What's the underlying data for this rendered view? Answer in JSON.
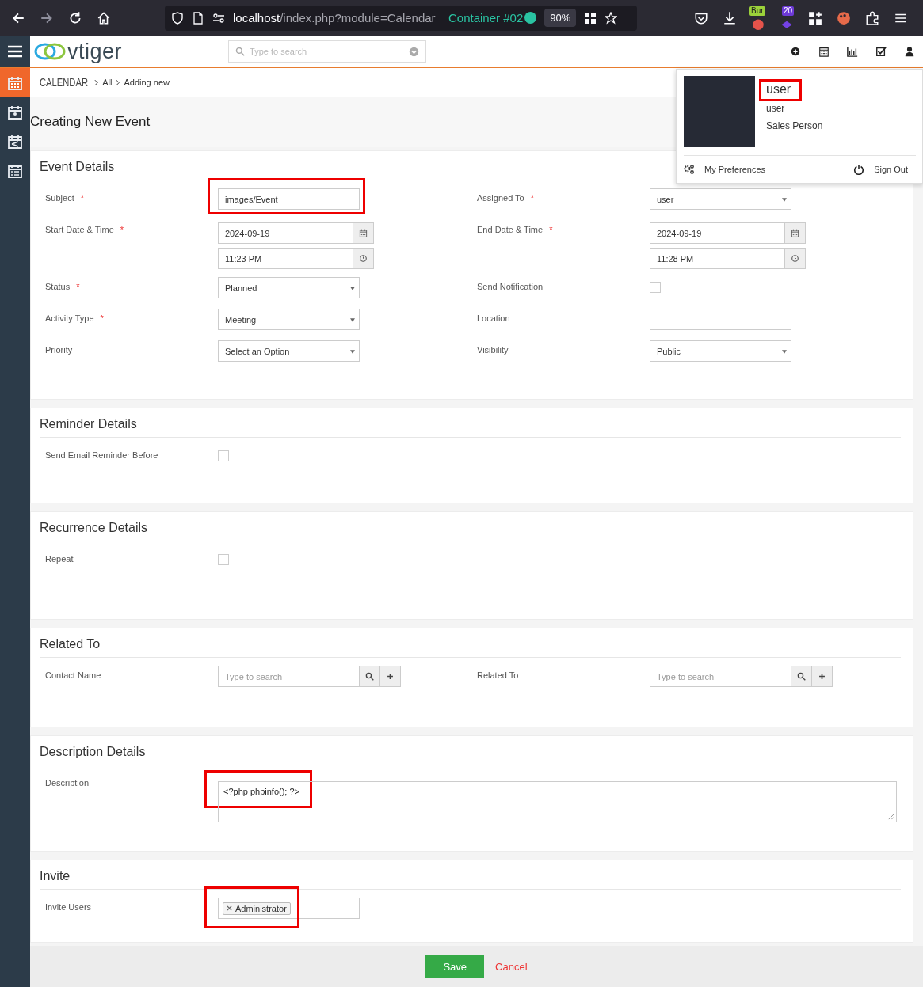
{
  "browser": {
    "url_host": "localhost",
    "url_path": "/index.php?module=Calendar",
    "container": "Container #02",
    "zoom": "90%",
    "badges": [
      "Bur",
      "20"
    ]
  },
  "app": {
    "logo": "vtiger",
    "search": {
      "placeholder": "Type to search"
    }
  },
  "sidebar": {
    "items": [
      {
        "selected": true
      },
      {
        "selected": false
      },
      {
        "selected": false
      },
      {
        "selected": false
      }
    ]
  },
  "breadcrumb": [
    "CALENDAR",
    "All",
    "Adding new"
  ],
  "title": "Creating New Event",
  "user_menu": {
    "name": "user",
    "name_highlighted": true,
    "username": "user",
    "role": "Sales Person",
    "actions": [
      "My Preferences",
      "Sign Out"
    ]
  },
  "sections": [
    {
      "title": "Event Details",
      "rows": [
        [
          {
            "label": "Subject",
            "mark": "*",
            "kind": "text",
            "value": "images/Event",
            "highlighted": true
          },
          {
            "label": "Assigned To",
            "mark": "*",
            "kind": "select",
            "value": "user"
          }
        ],
        [
          {
            "label": "Start Date & Time",
            "mark": "*",
            "kind": "datetime",
            "date": "2024-09-19",
            "time": "11:23 PM"
          },
          {
            "label": "End Date & Time",
            "mark": "*",
            "kind": "datetime",
            "date": "2024-09-19",
            "time": "11:28 PM"
          }
        ],
        [
          {
            "label": "Status",
            "mark": "*",
            "kind": "select",
            "value": "Planned"
          },
          {
            "label": "Send Notification",
            "kind": "checkbox",
            "checked": false
          }
        ],
        [
          {
            "label": "Activity Type",
            "mark": "*",
            "kind": "select",
            "value": "Meeting"
          },
          {
            "label": "Location",
            "kind": "text"
          }
        ],
        [
          {
            "label": "Priority",
            "kind": "select",
            "value": "Select an Option"
          },
          {
            "label": "Visibility",
            "kind": "select",
            "value": "Public"
          }
        ]
      ]
    },
    {
      "title": "Reminder Details",
      "rows": [
        [
          {
            "label": "Send Email Reminder Before",
            "kind": "checkbox",
            "checked": false
          }
        ]
      ]
    },
    {
      "title": "Recurrence Details",
      "rows": [
        [
          {
            "label": "Repeat",
            "kind": "checkbox",
            "checked": false
          }
        ]
      ]
    },
    {
      "title": "Related To",
      "rows": [
        [
          {
            "label": "Contact Name",
            "kind": "lookup",
            "placeholder": "Type to search"
          },
          {
            "label": "Related To",
            "kind": "lookup",
            "placeholder": "Type to search"
          }
        ]
      ]
    },
    {
      "title": "Description Details",
      "rows": [
        [
          {
            "label": "Description",
            "kind": "textarea",
            "value": "<?php phpinfo(); ?>",
            "highlighted": true
          }
        ]
      ]
    },
    {
      "title": "Invite",
      "rows": [
        [
          {
            "label": "Invite Users",
            "kind": "tags",
            "tags": [
              "Administrator"
            ],
            "highlighted": true
          }
        ]
      ]
    }
  ],
  "footer": {
    "save": "Save",
    "cancel": "Cancel"
  }
}
